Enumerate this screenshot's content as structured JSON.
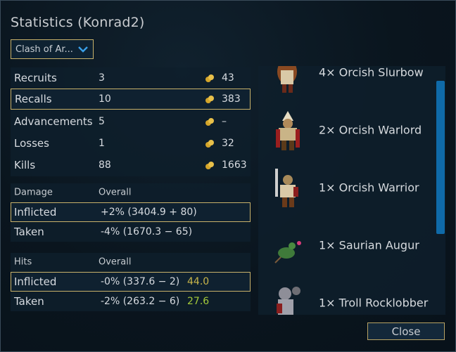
{
  "dialog": {
    "title": "Statistics (Konrad2)",
    "scenario_dropdown": "Clash of Ar...",
    "close_label": "Close"
  },
  "stats": [
    {
      "label": "Recruits",
      "count": "3",
      "gold": "43",
      "selected": false
    },
    {
      "label": "Recalls",
      "count": "10",
      "gold": "383",
      "selected": true
    },
    {
      "label": "Advancements",
      "count": "5",
      "gold": "–",
      "selected": false
    },
    {
      "label": "Losses",
      "count": "1",
      "gold": "32",
      "selected": false
    },
    {
      "label": "Kills",
      "count": "88",
      "gold": "1663",
      "selected": false
    }
  ],
  "damage": {
    "header": "Damage",
    "overall_label": "Overall",
    "inflicted_label": "Inflicted",
    "inflicted_value": "+2% (3404.9 + 80)",
    "taken_label": "Taken",
    "taken_value": "-4% (1670.3 − 65)"
  },
  "hits": {
    "header": "Hits",
    "overall_label": "Overall",
    "inflicted_label": "Inflicted",
    "inflicted_value": "-0% (337.6 − 2)",
    "inflicted_extra": "44.0",
    "taken_label": "Taken",
    "taken_value": "-2% (263.2 − 6)",
    "taken_extra": "27.6"
  },
  "units": [
    {
      "name": "4× Orcish Slurbow",
      "icon": "orc-slurbow"
    },
    {
      "name": "2× Orcish Warlord",
      "icon": "orc-warlord"
    },
    {
      "name": "1× Orcish Warrior",
      "icon": "orc-warrior"
    },
    {
      "name": "1× Saurian Augur",
      "icon": "saurian-augur"
    },
    {
      "name": "1× Troll Rocklobber",
      "icon": "troll-rocklobber"
    }
  ],
  "colors": {
    "accent_border": "#c8b16a",
    "scrollbar": "#0f6aa8",
    "extra_yellow": "#c9b64a",
    "extra_green": "#a4c93a"
  }
}
